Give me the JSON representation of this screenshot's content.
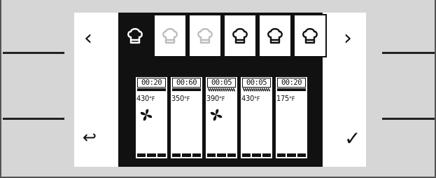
{
  "navigation": {
    "prev_icon": "chevron-left-icon",
    "next_icon": "chevron-right-icon",
    "back_icon": "return-arrow-icon",
    "confirm_icon": "checkmark-icon",
    "prev_glyph": "‹",
    "next_glyph": "›",
    "back_glyph": "↩",
    "confirm_glyph": "✓"
  },
  "programs": {
    "tabs": [
      {
        "icon": "chef-hat-icon",
        "state": "active"
      },
      {
        "icon": "chef-hat-icon",
        "state": "disabled"
      },
      {
        "icon": "chef-hat-icon",
        "state": "disabled"
      },
      {
        "icon": "chef-hat-icon",
        "state": "enabled"
      },
      {
        "icon": "chef-hat-icon",
        "state": "enabled"
      },
      {
        "icon": "chef-hat-icon",
        "state": "enabled"
      }
    ]
  },
  "steps": [
    {
      "time": "00:20",
      "temp": "430",
      "unit": "°F",
      "fan": true,
      "steam": false
    },
    {
      "time": "00:60",
      "temp": "350",
      "unit": "°F",
      "fan": false,
      "steam": false
    },
    {
      "time": "00:05",
      "temp": "390",
      "unit": "°F",
      "fan": true,
      "steam": true
    },
    {
      "time": "00:05",
      "temp": "430",
      "unit": "°F",
      "fan": false,
      "steam": true
    },
    {
      "time": "00:20",
      "temp": "175",
      "unit": "°F",
      "fan": false,
      "steam": false
    }
  ],
  "colors": {
    "ink": "#111111",
    "screen": "#ffffff",
    "bezel": "#d6d6d6",
    "disabled": "#bdbdbd"
  }
}
